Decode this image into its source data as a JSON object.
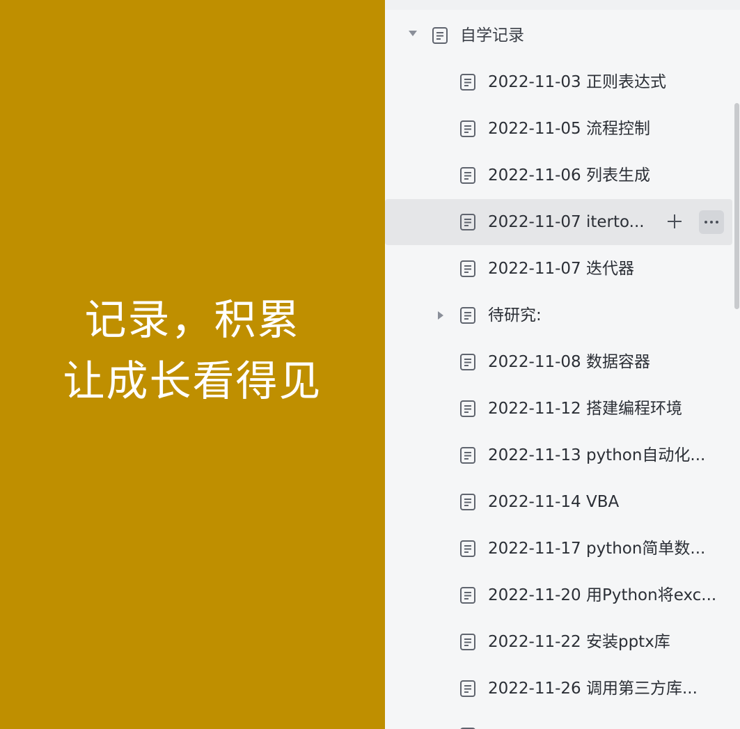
{
  "banner": {
    "line1": "记录，积累",
    "line2": "让成长看得见",
    "background": "#bf8f00",
    "text_color": "#ffffff"
  },
  "tree": {
    "root": {
      "label": "自学记录",
      "icon": "document-icon",
      "expanded": true
    },
    "items": [
      {
        "label": "2022-11-03 正则表达式",
        "icon": "document-icon"
      },
      {
        "label": "2022-11-05 流程控制",
        "icon": "document-icon"
      },
      {
        "label": "2022-11-06 列表生成",
        "icon": "document-icon"
      },
      {
        "label": "2022-11-07 iterto...",
        "icon": "document-icon",
        "hovered": true
      },
      {
        "label": "2022-11-07 迭代器",
        "icon": "document-icon"
      },
      {
        "label": "待研究:",
        "icon": "document-icon",
        "collapsed_children": true
      },
      {
        "label": "2022-11-08 数据容器",
        "icon": "document-icon"
      },
      {
        "label": "2022-11-12 搭建编程环境",
        "icon": "document-icon"
      },
      {
        "label": "2022-11-13 python自动化...",
        "icon": "document-icon"
      },
      {
        "label": "2022-11-14 VBA",
        "icon": "document-icon"
      },
      {
        "label": "2022-11-17 python简单数...",
        "icon": "document-icon"
      },
      {
        "label": "2022-11-20 用Python将exc...",
        "icon": "document-icon"
      },
      {
        "label": "2022-11-22 安装pptx库",
        "icon": "document-icon"
      },
      {
        "label": "2022-11-26 调用第三方库...",
        "icon": "document-icon"
      }
    ],
    "hover_actions": {
      "add_icon": "plus-icon",
      "more_icon": "more-horizontal-icon"
    },
    "colors": {
      "panel_bg": "#f5f6f7",
      "hover_bg": "#e5e6e8",
      "text": "#2b2f36",
      "icon": "#5f646e"
    }
  }
}
